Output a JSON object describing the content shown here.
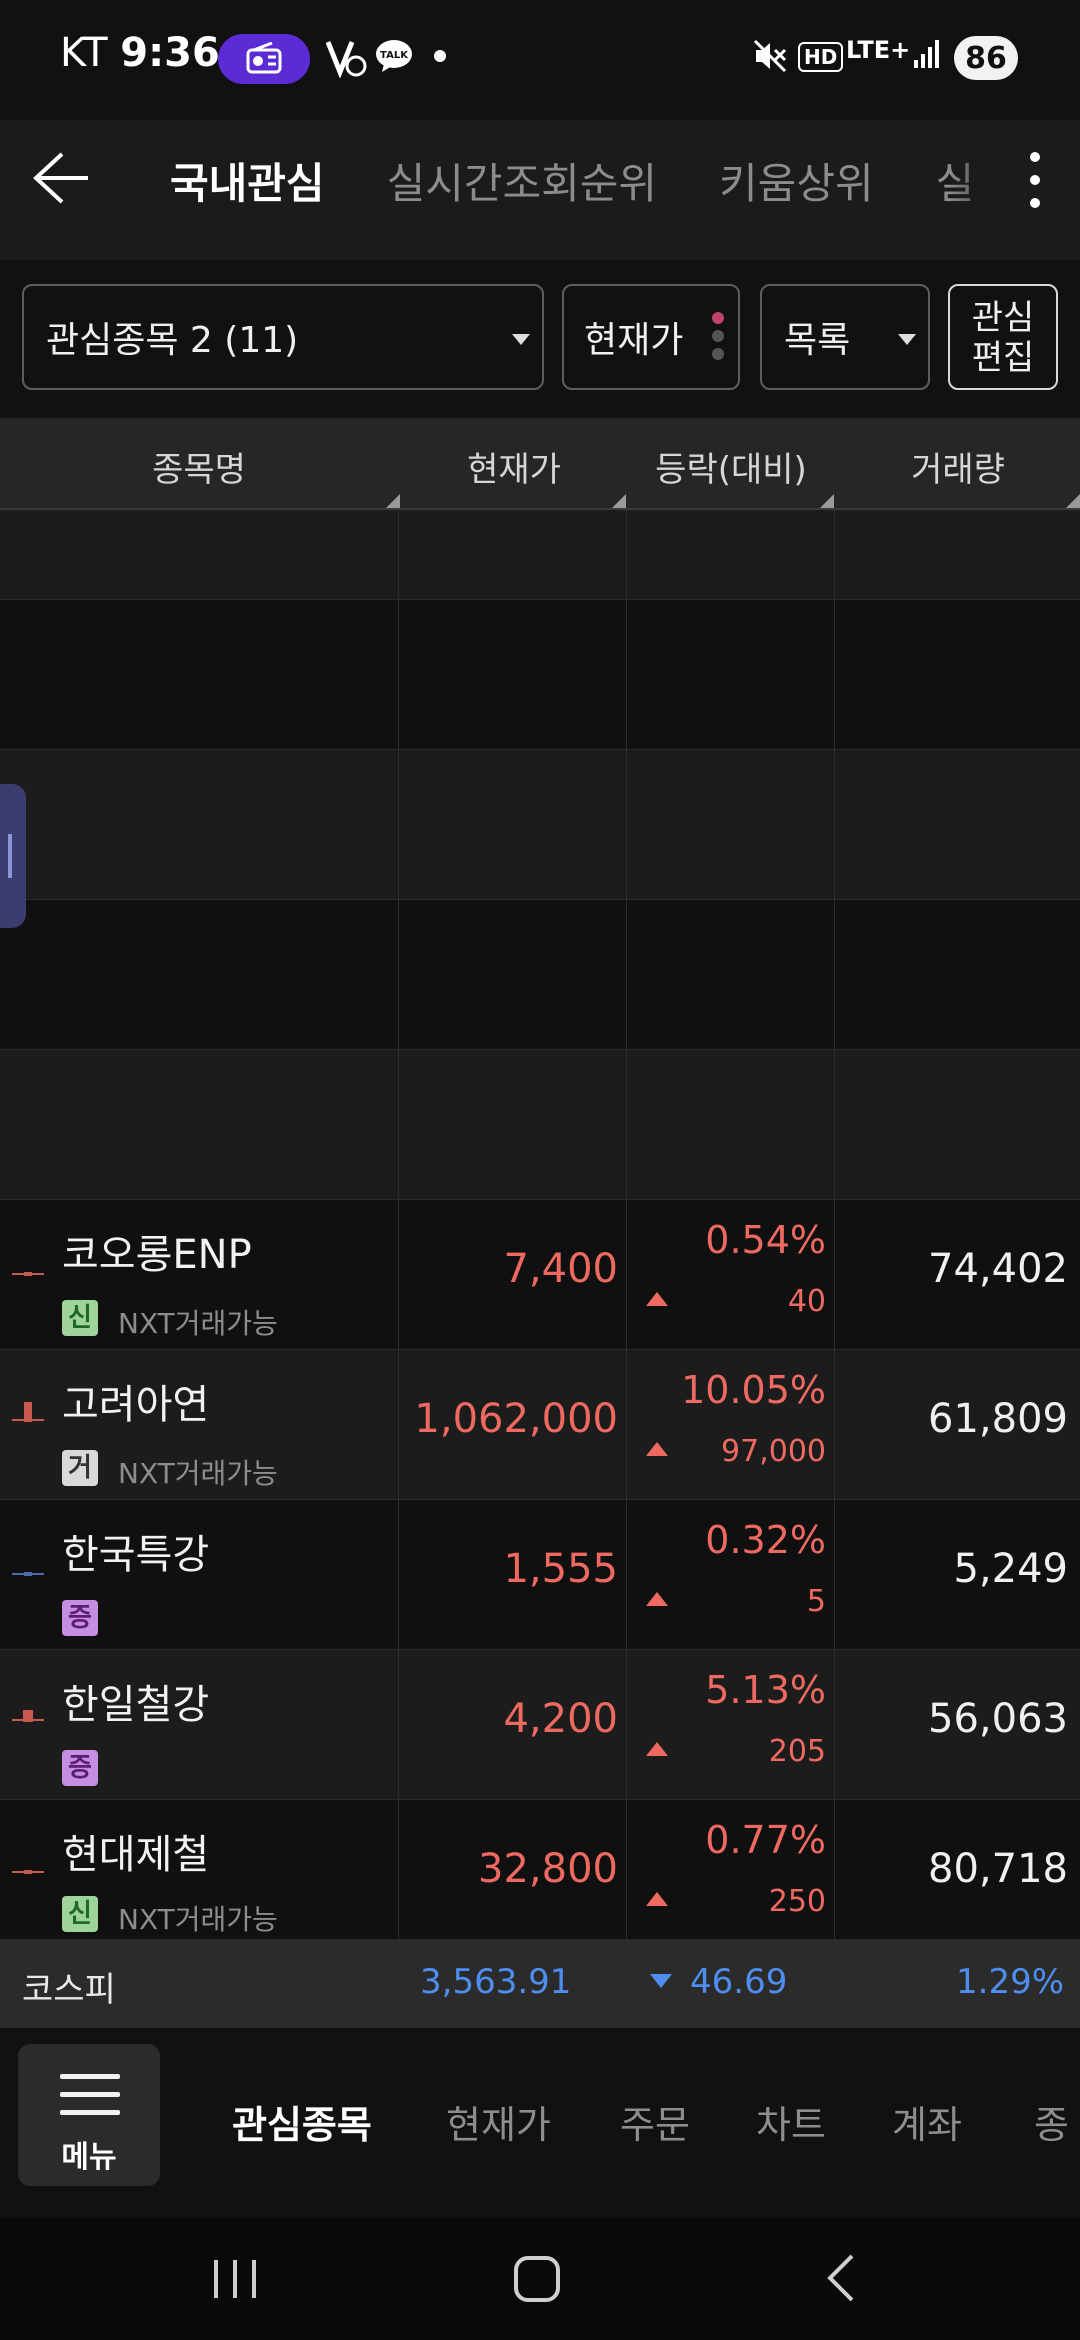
{
  "status_bar": {
    "carrier": "KT",
    "time": "9:36",
    "talk_icon": "kakaotalk-icon",
    "network": "LTE+",
    "hd": "HD",
    "battery": "86"
  },
  "header": {
    "tabs": [
      {
        "label": "국내관심",
        "active": true
      },
      {
        "label": "실시간조회순위",
        "active": false
      },
      {
        "label": "키움상위",
        "active": false
      },
      {
        "label": "실",
        "active": false
      }
    ]
  },
  "filters": {
    "group_select": "관심종목 2 (11)",
    "view_mode": "현재가",
    "list_mode": "목록",
    "edit_label_line1": "관심",
    "edit_label_line2": "편집"
  },
  "columns": {
    "name": "종목명",
    "price": "현재가",
    "change": "등락(대비)",
    "volume": "거래량"
  },
  "stocks": [
    {
      "name": "코오롱ENP",
      "badge": "신",
      "badge_type": "shin",
      "nxt": "NXT거래가능",
      "price": "7,400",
      "change_pct": "0.54%",
      "change_amt": "40",
      "volume": "74,402"
    },
    {
      "name": "고려아연",
      "badge": "거",
      "badge_type": "geo",
      "nxt": "NXT거래가능",
      "price": "1,062,000",
      "change_pct": "10.05%",
      "change_amt": "97,000",
      "volume": "61,809"
    },
    {
      "name": "한국특강",
      "badge": "증",
      "badge_type": "jeung",
      "nxt": "",
      "price": "1,555",
      "change_pct": "0.32%",
      "change_amt": "5",
      "volume": "5,249"
    },
    {
      "name": "한일철강",
      "badge": "증",
      "badge_type": "jeung",
      "nxt": "",
      "price": "4,200",
      "change_pct": "5.13%",
      "change_amt": "205",
      "volume": "56,063"
    },
    {
      "name": "현대제철",
      "badge": "신",
      "badge_type": "shin",
      "nxt": "NXT거래가능",
      "price": "32,800",
      "change_pct": "0.77%",
      "change_amt": "250",
      "volume": "80,718"
    }
  ],
  "index": {
    "name": "코스피",
    "value": "3,563.91",
    "change": "46.69",
    "change_pct": "1.29%"
  },
  "bottom_nav": {
    "menu_label": "메뉴",
    "items": [
      {
        "label": "관심종목",
        "active": true
      },
      {
        "label": "현재가",
        "active": false
      },
      {
        "label": "주문",
        "active": false
      },
      {
        "label": "차트",
        "active": false
      },
      {
        "label": "계좌",
        "active": false
      },
      {
        "label": "종",
        "active": false
      }
    ]
  },
  "colors": {
    "up_red": "#ee6a60",
    "down_blue": "#4d8ef0",
    "background": "#111111"
  }
}
